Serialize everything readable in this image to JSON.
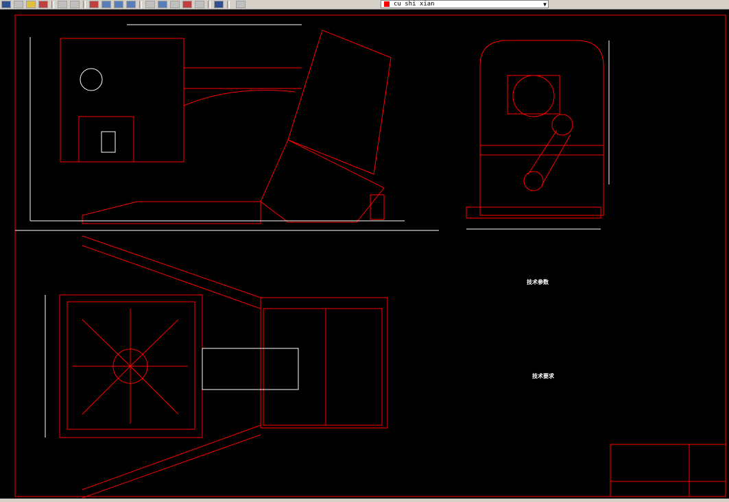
{
  "toolbar": {
    "icons": [
      "cut-icon",
      "copy-icon",
      "paste-icon",
      "match-properties-icon",
      "undo-icon",
      "redo-icon",
      "pan-icon",
      "zoom-realtime-icon",
      "zoom-window-icon",
      "zoom-previous-icon",
      "properties-icon",
      "design-center-icon",
      "tool-palettes-icon",
      "calculator-icon",
      "help-icon",
      "layer-manager-icon",
      "layer-previous-icon"
    ],
    "layer_name": "cu shi xian",
    "layer_color": "#ff0000"
  },
  "drawing": {
    "background": "#000000",
    "line_color": "#ff0000",
    "dim_color": "#ffffff",
    "tech_params_title": "技术参数",
    "tech_requirements_title": "技术要求"
  }
}
